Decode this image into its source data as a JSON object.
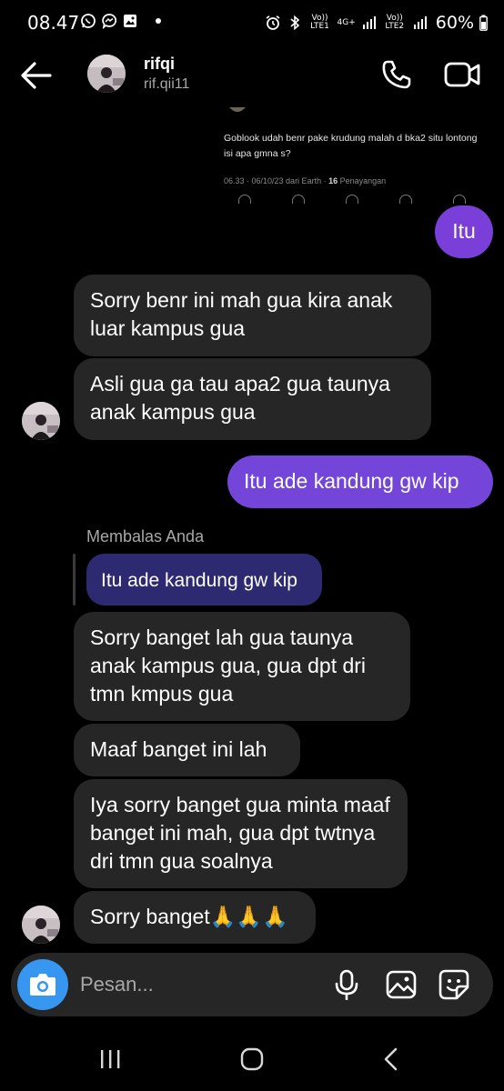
{
  "status_bar": {
    "time": "08.47",
    "network1": "Vo)) LTE1",
    "network1_gen": "4G+",
    "network2": "Vo)) LTE2",
    "battery": "60%"
  },
  "header": {
    "name": "rifqi",
    "username": "rif.qii11"
  },
  "shared_post": {
    "text": "Goblook udah benr pake krudung malah d bka2 situ lontong isi apa gmna s?",
    "meta_time": "06.33 · 06/10/23 dari Earth · ",
    "views_count": "16",
    "views_label": " Penayangan"
  },
  "messages": {
    "m1": "Itu",
    "m2": "Sorry benr ini mah gua kira anak luar kampus gua",
    "m3": "Asli gua ga tau apa2 gua taunya anak kampus gua",
    "m4": "Itu ade kandung gw kip",
    "reply_label": "Membalas Anda",
    "reply_quote": "Itu ade kandung gw kip",
    "m5": "Sorry banget lah gua taunya anak kampus gua, gua dpt dri tmn kmpus gua",
    "m6": "Maaf banget ini lah",
    "m7": "Iya sorry banget gua minta maaf banget ini mah, gua dpt twtnya dri tmn gua soalnya",
    "m8": "Sorry banget🙏🙏🙏"
  },
  "composer": {
    "placeholder": "Pesan..."
  },
  "icons": [
    "whatsapp-icon",
    "messenger-icon",
    "gallery-icon",
    "alarm-icon",
    "bluetooth-icon",
    "signal-icon",
    "battery-icon",
    "back-arrow-icon",
    "phone-icon",
    "video-icon",
    "camera-icon",
    "mic-icon",
    "image-icon",
    "sticker-icon",
    "recent-apps-icon",
    "home-icon",
    "nav-back-icon"
  ],
  "colors": {
    "outgoing_bubble": "#7346d9",
    "incoming_bubble": "#262626",
    "replied_bubble": "#2e2a72",
    "camera_button": "#3797f0"
  }
}
